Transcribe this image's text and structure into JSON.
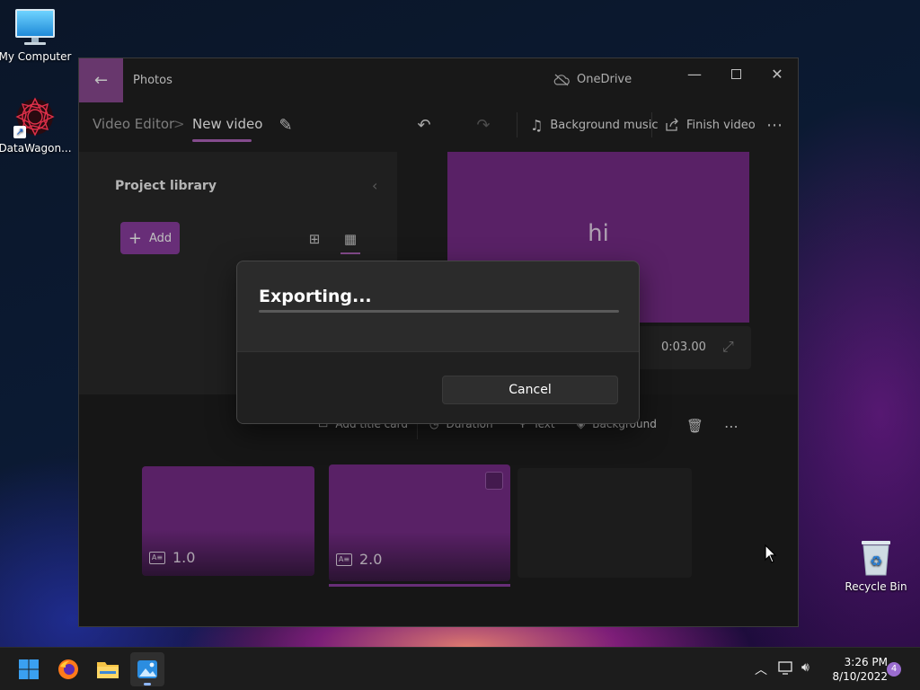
{
  "desktop": {
    "icons": [
      {
        "label": "My Computer"
      },
      {
        "label": "DataWagon..."
      },
      {
        "label": "Recycle Bin"
      }
    ]
  },
  "window": {
    "app_title": "Photos",
    "onedrive_label": "OneDrive",
    "breadcrumb": {
      "root": "Video Editor",
      "separator": ">",
      "current": "New video"
    },
    "toolbar": {
      "background_music": "Background music",
      "finish_video": "Finish video"
    },
    "library": {
      "title": "Project library",
      "add_label": "Add"
    },
    "preview": {
      "text": "hi",
      "time": "0:03.00"
    },
    "storyboard": {
      "tools": {
        "add_title_card": "Add title card",
        "duration": "Duration",
        "text": "Text",
        "background": "Background"
      },
      "clips": [
        {
          "duration": "1.0",
          "selected": false
        },
        {
          "duration": "2.0",
          "selected": true
        }
      ]
    }
  },
  "dialog": {
    "title": "Exporting...",
    "progress": 0,
    "cancel_label": "Cancel"
  },
  "taskbar": {
    "apps": [
      "start-icon",
      "firefox-icon",
      "file-explorer-icon",
      "photos-icon"
    ],
    "time": "3:26 PM",
    "date": "8/10/2022",
    "notifications": "4"
  },
  "colors": {
    "accent": "#8b3ea0",
    "preview": "#772c88"
  }
}
